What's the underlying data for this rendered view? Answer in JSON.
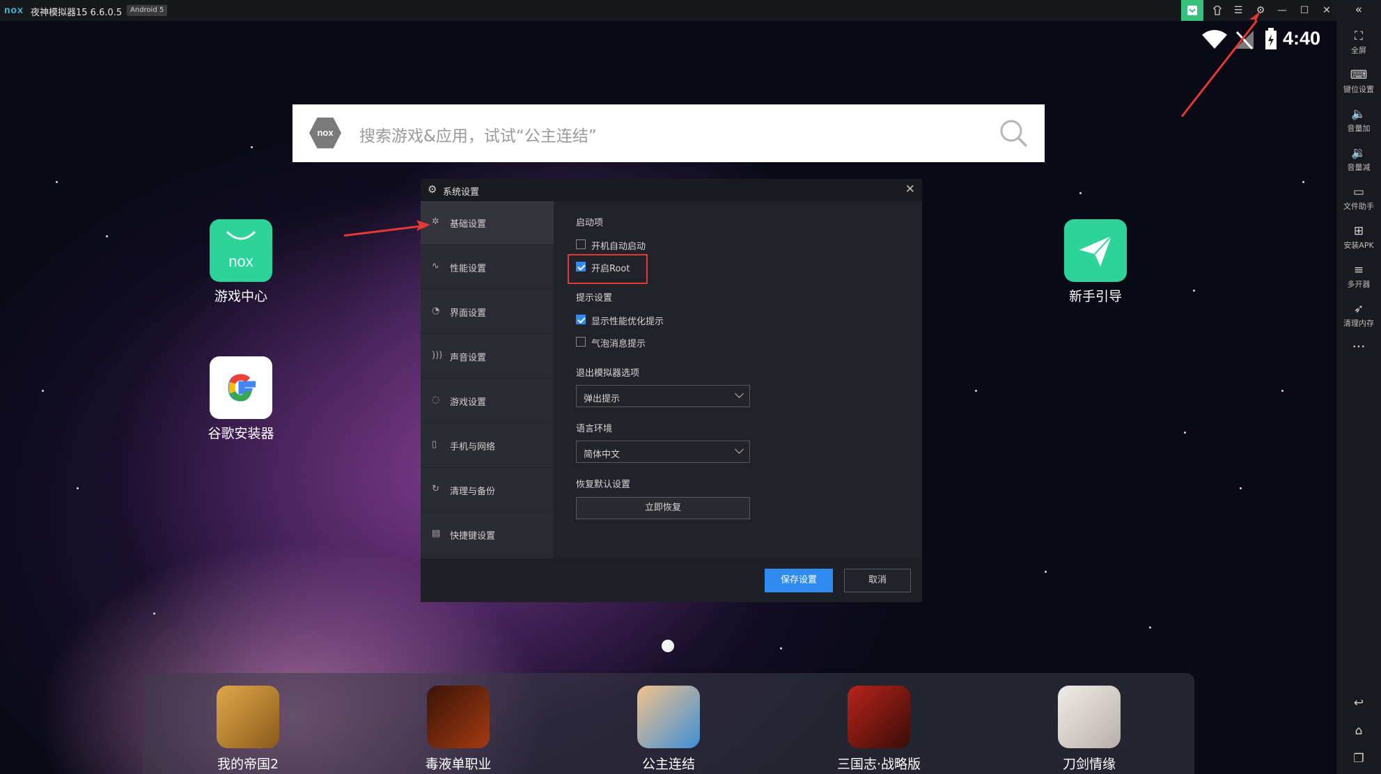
{
  "titlebar": {
    "logo": "nox",
    "title": "夜神模拟器15 6.6.0.5",
    "android_badge": "Android 5",
    "buttons": [
      "gift-icon",
      "skin-icon",
      "menu-icon",
      "settings-icon",
      "minimize-icon",
      "maximize-icon",
      "close-icon"
    ]
  },
  "status": {
    "time": "4:40"
  },
  "search": {
    "placeholder": "搜索游戏&应用，试试“公主连结”",
    "badge": "nox"
  },
  "desktop": {
    "apps": [
      {
        "label": "游戏中心"
      },
      {
        "label": "谷歌安装器"
      },
      {
        "label": "新手引导"
      }
    ]
  },
  "sidebar": {
    "items": [
      {
        "label": "全屏",
        "icon": "fullscreen-icon"
      },
      {
        "label": "键位设置",
        "icon": "keyboard-icon"
      },
      {
        "label": "音量加",
        "icon": "volume-up-icon"
      },
      {
        "label": "音量减",
        "icon": "volume-down-icon"
      },
      {
        "label": "文件助手",
        "icon": "file-icon"
      },
      {
        "label": "安装APK",
        "icon": "apk-icon"
      },
      {
        "label": "多开器",
        "icon": "multi-instance-icon"
      },
      {
        "label": "清理内存",
        "icon": "rocket-icon"
      }
    ],
    "more": "···"
  },
  "dialog": {
    "title": "系统设置",
    "nav": [
      {
        "label": "基础设置",
        "icon": "puzzle-icon",
        "active": true
      },
      {
        "label": "性能设置",
        "icon": "pulse-icon"
      },
      {
        "label": "界面设置",
        "icon": "palette-icon"
      },
      {
        "label": "声音设置",
        "icon": "sound-icon"
      },
      {
        "label": "游戏设置",
        "icon": "gamepad-icon"
      },
      {
        "label": "手机与网络",
        "icon": "phone-icon"
      },
      {
        "label": "清理与备份",
        "icon": "backup-icon"
      },
      {
        "label": "快捷键设置",
        "icon": "keyboard-icon"
      }
    ],
    "startup": {
      "heading": "启动项",
      "auto_start": {
        "label": "开机自动启动",
        "checked": false
      },
      "root": {
        "label": "开启Root",
        "checked": true
      }
    },
    "hints": {
      "heading": "提示设置",
      "perf_hint": {
        "label": "显示性能优化提示",
        "checked": true
      },
      "bubble_hint": {
        "label": "气泡消息提示",
        "checked": false
      }
    },
    "exit": {
      "heading": "退出模拟器选项",
      "value": "弹出提示"
    },
    "language": {
      "heading": "语言环境",
      "value": "简体中文"
    },
    "restore": {
      "heading": "恢复默认设置",
      "button": "立即恢复"
    },
    "save_button": "保存设置",
    "cancel_button": "取消"
  },
  "dock": {
    "apps": [
      {
        "label": "我的帝国2",
        "color": "#c98a3a"
      },
      {
        "label": "毒液单职业",
        "color": "#7a2a10"
      },
      {
        "label": "公主连结",
        "color": "#4aa7e8"
      },
      {
        "label": "三国志·战略版",
        "color": "#8a1a12"
      },
      {
        "label": "刀剑情缘",
        "color": "#d8d0cc"
      }
    ]
  },
  "colors": {
    "accent": "#2f8bef",
    "annotation": "#e53935",
    "nox_green": "#35c17b"
  }
}
